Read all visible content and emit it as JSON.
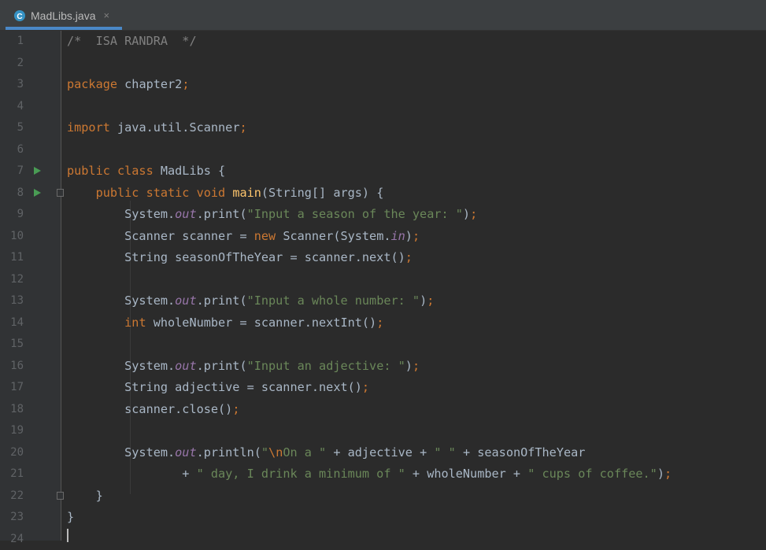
{
  "tab": {
    "filename": "MadLibs.java",
    "close": "×"
  },
  "lines": [
    {
      "n": "1",
      "t": [
        {
          "c": "cmt",
          "s": "/*  ISA RANDRA  */"
        }
      ]
    },
    {
      "n": "2",
      "t": []
    },
    {
      "n": "3",
      "t": [
        {
          "c": "kw",
          "s": "package"
        },
        {
          "c": "",
          "s": " chapter2"
        },
        {
          "c": "kw",
          "s": ";"
        }
      ]
    },
    {
      "n": "4",
      "t": []
    },
    {
      "n": "5",
      "t": [
        {
          "c": "kw",
          "s": "import"
        },
        {
          "c": "",
          "s": " java.util.Scanner"
        },
        {
          "c": "kw",
          "s": ";"
        }
      ]
    },
    {
      "n": "6",
      "t": []
    },
    {
      "n": "7",
      "run": true,
      "t": [
        {
          "c": "kw",
          "s": "public class"
        },
        {
          "c": "",
          "s": " MadLibs {"
        }
      ]
    },
    {
      "n": "8",
      "run": true,
      "fold": true,
      "t": [
        {
          "c": "",
          "s": "    "
        },
        {
          "c": "kw",
          "s": "public static void"
        },
        {
          "c": "",
          "s": " "
        },
        {
          "c": "fn",
          "s": "main"
        },
        {
          "c": "",
          "s": "(String[] args) {"
        }
      ]
    },
    {
      "n": "9",
      "t": [
        {
          "c": "",
          "s": "        System."
        },
        {
          "c": "fld",
          "s": "out"
        },
        {
          "c": "",
          "s": ".print("
        },
        {
          "c": "str",
          "s": "\"Input a season of the year: \""
        },
        {
          "c": "",
          "s": ")"
        },
        {
          "c": "kw",
          "s": ";"
        }
      ]
    },
    {
      "n": "10",
      "t": [
        {
          "c": "",
          "s": "        Scanner scanner = "
        },
        {
          "c": "kw",
          "s": "new"
        },
        {
          "c": "",
          "s": " Scanner(System."
        },
        {
          "c": "fld",
          "s": "in"
        },
        {
          "c": "",
          "s": ")"
        },
        {
          "c": "kw",
          "s": ";"
        }
      ]
    },
    {
      "n": "11",
      "t": [
        {
          "c": "",
          "s": "        String seasonOfTheYear = scanner.next()"
        },
        {
          "c": "kw",
          "s": ";"
        }
      ]
    },
    {
      "n": "12",
      "t": []
    },
    {
      "n": "13",
      "t": [
        {
          "c": "",
          "s": "        System."
        },
        {
          "c": "fld",
          "s": "out"
        },
        {
          "c": "",
          "s": ".print("
        },
        {
          "c": "str",
          "s": "\"Input a whole number: \""
        },
        {
          "c": "",
          "s": ")"
        },
        {
          "c": "kw",
          "s": ";"
        }
      ]
    },
    {
      "n": "14",
      "t": [
        {
          "c": "",
          "s": "        "
        },
        {
          "c": "kw",
          "s": "int"
        },
        {
          "c": "",
          "s": " wholeNumber = scanner.nextInt()"
        },
        {
          "c": "kw",
          "s": ";"
        }
      ]
    },
    {
      "n": "15",
      "t": []
    },
    {
      "n": "16",
      "t": [
        {
          "c": "",
          "s": "        System."
        },
        {
          "c": "fld",
          "s": "out"
        },
        {
          "c": "",
          "s": ".print("
        },
        {
          "c": "str",
          "s": "\"Input an adjective: \""
        },
        {
          "c": "",
          "s": ")"
        },
        {
          "c": "kw",
          "s": ";"
        }
      ]
    },
    {
      "n": "17",
      "t": [
        {
          "c": "",
          "s": "        String adjective = scanner.next()"
        },
        {
          "c": "kw",
          "s": ";"
        }
      ]
    },
    {
      "n": "18",
      "t": [
        {
          "c": "",
          "s": "        scanner.close()"
        },
        {
          "c": "kw",
          "s": ";"
        }
      ]
    },
    {
      "n": "19",
      "t": []
    },
    {
      "n": "20",
      "t": [
        {
          "c": "",
          "s": "        System."
        },
        {
          "c": "fld",
          "s": "out"
        },
        {
          "c": "",
          "s": ".println("
        },
        {
          "c": "str",
          "s": "\""
        },
        {
          "c": "esc",
          "s": "\\n"
        },
        {
          "c": "str",
          "s": "On a \""
        },
        {
          "c": "",
          "s": " + adjective + "
        },
        {
          "c": "str",
          "s": "\" \""
        },
        {
          "c": "",
          "s": " + seasonOfTheYear"
        }
      ]
    },
    {
      "n": "21",
      "t": [
        {
          "c": "",
          "s": "                + "
        },
        {
          "c": "str",
          "s": "\" day, I drink a minimum of \""
        },
        {
          "c": "",
          "s": " + wholeNumber + "
        },
        {
          "c": "str",
          "s": "\" cups of coffee.\""
        },
        {
          "c": "",
          "s": ")"
        },
        {
          "c": "kw",
          "s": ";"
        }
      ]
    },
    {
      "n": "22",
      "fold": true,
      "t": [
        {
          "c": "",
          "s": "    }"
        }
      ]
    },
    {
      "n": "23",
      "t": [
        {
          "c": "",
          "s": "}"
        }
      ]
    },
    {
      "n": "24",
      "t": []
    }
  ]
}
